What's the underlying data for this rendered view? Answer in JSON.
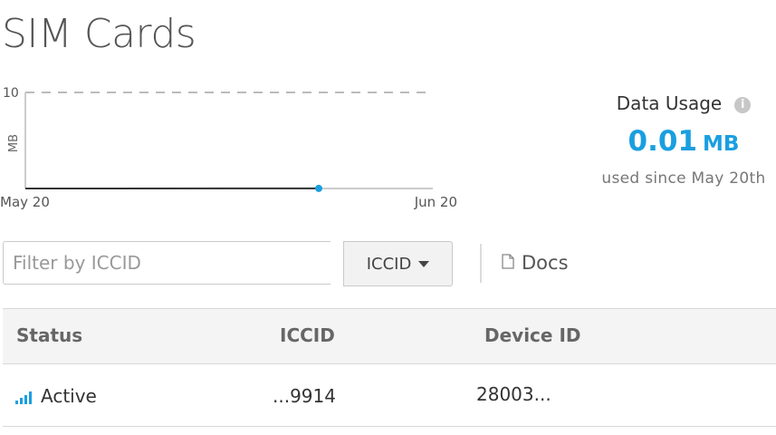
{
  "page": {
    "title": "SIM Cards"
  },
  "chart_data": {
    "type": "line",
    "x": [
      "May 20",
      "Jun 20"
    ],
    "xlabel": "",
    "ylabel": "MB",
    "ylim": [
      0,
      10
    ],
    "y_tick_labels": [
      "10"
    ],
    "x_tick_labels": [
      "May 20",
      "Jun 20"
    ],
    "series": [
      {
        "values": [
          0,
          0
        ]
      }
    ],
    "highlight_point": {
      "position_fraction": 0.72,
      "value": 0.01
    },
    "grid": true,
    "colors": {
      "line": "#333333",
      "point": "#1a9fe0",
      "grid": "#bbbbbb"
    }
  },
  "usage": {
    "title": "Data Usage",
    "info_icon": "info-icon",
    "value": "0.01",
    "unit": "MB",
    "subtitle": "used since May 20th",
    "color": "#1a9fe0"
  },
  "filter": {
    "placeholder": "Filter by ICCID",
    "value": "",
    "select_label": "ICCID",
    "docs_label": "Docs",
    "docs_icon": "document-icon"
  },
  "table": {
    "columns": [
      "Status",
      "ICCID",
      "Device ID"
    ],
    "rows": [
      {
        "status": "Active",
        "status_icon": "signal-bars-icon",
        "iccid": "...9914",
        "device_id": "28003..."
      }
    ]
  }
}
